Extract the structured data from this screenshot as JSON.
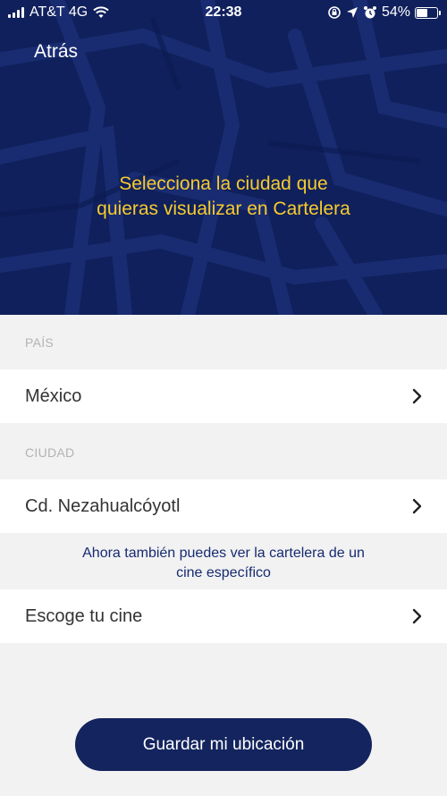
{
  "status_bar": {
    "carrier": "AT&T 4G",
    "time": "22:38",
    "battery_percent": "54%",
    "battery_level": 0.54,
    "icons": [
      "signal-icon",
      "wifi-icon",
      "screen-rotation-lock-icon",
      "location-arrow-icon",
      "alarm-icon",
      "battery-icon"
    ]
  },
  "header": {
    "back_label": "Atrás",
    "title": "Selecciona la ciudad que\nquieras visualizar en Cartelera"
  },
  "country_section": {
    "label": "PAÍS",
    "value": "México"
  },
  "city_section": {
    "label": "CIUDAD",
    "value": "Cd. Nezahualcóyotl"
  },
  "notice": "Ahora también puedes ver la cartelera de un\ncine específico",
  "cinema_row": {
    "label": "Escoge tu cine"
  },
  "save_button": {
    "label": "Guardar mi ubicación"
  },
  "colors": {
    "header_bg": "#10205c",
    "title_yellow": "#f7cb2e",
    "button_bg": "#13245e",
    "notice_text": "#162a72"
  }
}
